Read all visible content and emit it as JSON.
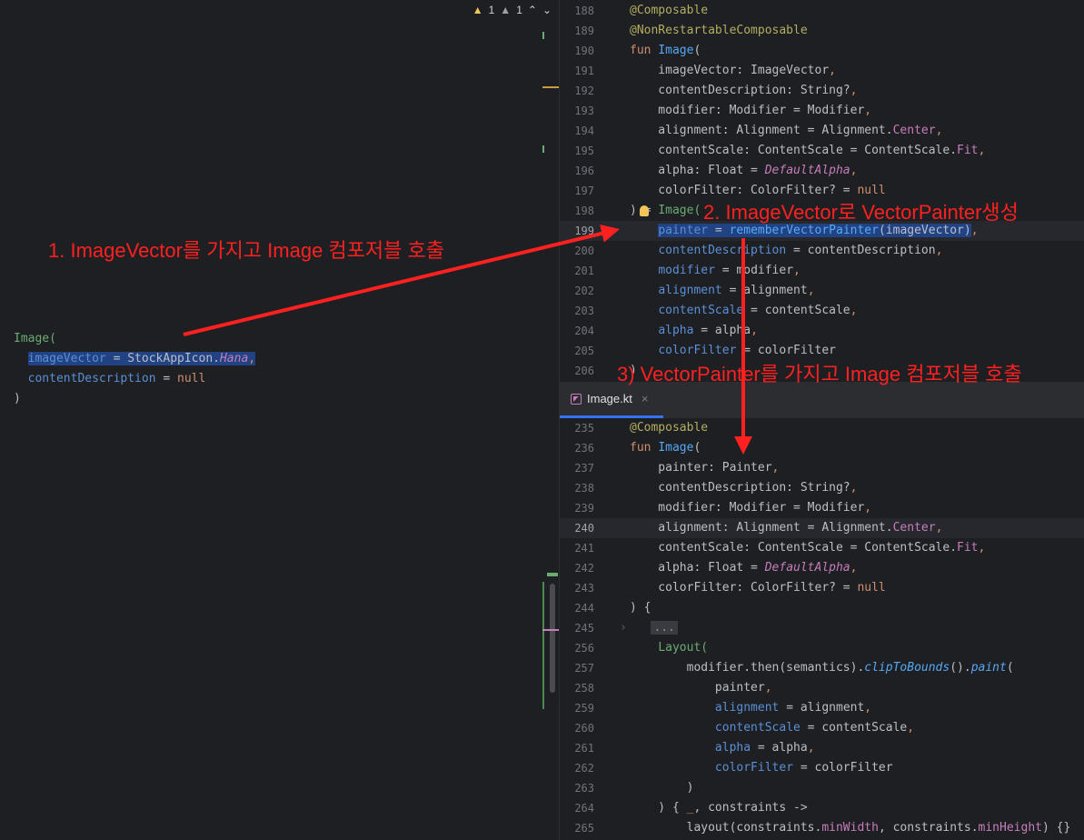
{
  "status": {
    "warnings": "1",
    "weak_warnings": "1",
    "up_arrow": "⌃",
    "down_arrow": "⌄"
  },
  "left_code": {
    "lines": [
      {
        "tokens": [
          {
            "t": "Image(",
            "c": "green"
          }
        ]
      },
      {
        "tokens": [
          {
            "t": "  ",
            "c": ""
          },
          {
            "t": "imageVector",
            "c": "param hl"
          },
          {
            "t": " = ",
            "c": "hl"
          },
          {
            "t": "StockAppIcon.",
            "c": "hl"
          },
          {
            "t": "Hana",
            "c": "ital hl"
          },
          {
            "t": ",",
            "c": "kw hl"
          }
        ]
      },
      {
        "tokens": [
          {
            "t": "  ",
            "c": ""
          },
          {
            "t": "contentDescription",
            "c": "param"
          },
          {
            "t": " = ",
            "c": ""
          },
          {
            "t": "null",
            "c": "kw"
          }
        ]
      },
      {
        "tokens": [
          {
            "t": ")",
            "c": ""
          }
        ]
      }
    ]
  },
  "top_code": {
    "lines": [
      {
        "n": "188",
        "tokens": [
          {
            "t": "@Composable",
            "c": "anno"
          }
        ]
      },
      {
        "n": "189",
        "tokens": [
          {
            "t": "@NonRestartableComposable",
            "c": "anno"
          }
        ]
      },
      {
        "n": "190",
        "tokens": [
          {
            "t": "fun ",
            "c": "kw"
          },
          {
            "t": "Image",
            "c": "fn"
          },
          {
            "t": "(",
            "c": ""
          }
        ]
      },
      {
        "n": "191",
        "tokens": [
          {
            "t": "    imageVector: ImageVector",
            "c": ""
          },
          {
            "t": ",",
            "c": "kw"
          }
        ]
      },
      {
        "n": "192",
        "tokens": [
          {
            "t": "    contentDescription: String?",
            "c": ""
          },
          {
            "t": ",",
            "c": "kw"
          }
        ]
      },
      {
        "n": "193",
        "tokens": [
          {
            "t": "    modifier: Modifier = Modifier",
            "c": ""
          },
          {
            "t": ",",
            "c": "kw"
          }
        ]
      },
      {
        "n": "194",
        "tokens": [
          {
            "t": "    alignment: Alignment = Alignment.",
            "c": ""
          },
          {
            "t": "Center",
            "c": "enumc"
          },
          {
            "t": ",",
            "c": "kw"
          }
        ]
      },
      {
        "n": "195",
        "tokens": [
          {
            "t": "    contentScale: ContentScale = ContentScale.",
            "c": ""
          },
          {
            "t": "Fit",
            "c": "enumc"
          },
          {
            "t": ",",
            "c": "kw"
          }
        ]
      },
      {
        "n": "196",
        "tokens": [
          {
            "t": "    alpha: Float = ",
            "c": ""
          },
          {
            "t": "DefaultAlpha",
            "c": "ital"
          },
          {
            "t": ",",
            "c": "kw"
          }
        ]
      },
      {
        "n": "197",
        "tokens": [
          {
            "t": "    colorFilter: ColorFilter? = ",
            "c": ""
          },
          {
            "t": "null",
            "c": "kw"
          }
        ]
      },
      {
        "n": "198",
        "tokens": [
          {
            "t": ") = ",
            "c": ""
          },
          {
            "t": "Image(",
            "c": "green"
          }
        ]
      },
      {
        "n": "199",
        "cur": true,
        "tokens": [
          {
            "t": "    ",
            "c": ""
          },
          {
            "t": "painter",
            "c": "param hl"
          },
          {
            "t": " = ",
            "c": "hl"
          },
          {
            "t": "rememberVectorPainter",
            "c": "fncall hl"
          },
          {
            "t": "(imageVector)",
            "c": "hl"
          },
          {
            "t": ",",
            "c": "kw"
          }
        ]
      },
      {
        "n": "200",
        "tokens": [
          {
            "t": "    ",
            "c": ""
          },
          {
            "t": "contentDescription",
            "c": "param"
          },
          {
            "t": " = contentDescription",
            "c": ""
          },
          {
            "t": ",",
            "c": "kw"
          }
        ]
      },
      {
        "n": "201",
        "tokens": [
          {
            "t": "    ",
            "c": ""
          },
          {
            "t": "modifier",
            "c": "param"
          },
          {
            "t": " = modifier",
            "c": ""
          },
          {
            "t": ",",
            "c": "kw"
          }
        ]
      },
      {
        "n": "202",
        "tokens": [
          {
            "t": "    ",
            "c": ""
          },
          {
            "t": "alignment",
            "c": "param"
          },
          {
            "t": " = alignment",
            "c": ""
          },
          {
            "t": ",",
            "c": "kw"
          }
        ]
      },
      {
        "n": "203",
        "tokens": [
          {
            "t": "    ",
            "c": ""
          },
          {
            "t": "contentScale",
            "c": "param"
          },
          {
            "t": " = contentScale",
            "c": ""
          },
          {
            "t": ",",
            "c": "kw"
          }
        ]
      },
      {
        "n": "204",
        "tokens": [
          {
            "t": "    ",
            "c": ""
          },
          {
            "t": "alpha",
            "c": "param"
          },
          {
            "t": " = alpha",
            "c": ""
          },
          {
            "t": ",",
            "c": "kw"
          }
        ]
      },
      {
        "n": "205",
        "tokens": [
          {
            "t": "    ",
            "c": ""
          },
          {
            "t": "colorFilter",
            "c": "param"
          },
          {
            "t": " = colorFilter",
            "c": ""
          }
        ]
      },
      {
        "n": "206",
        "tokens": [
          {
            "t": ")",
            "c": ""
          }
        ]
      }
    ]
  },
  "tab": {
    "label": "Image.kt",
    "close": "×"
  },
  "bottom_code": {
    "lines": [
      {
        "n": "235",
        "tokens": [
          {
            "t": "@Composable",
            "c": "anno"
          }
        ]
      },
      {
        "n": "236",
        "tokens": [
          {
            "t": "fun ",
            "c": "kw"
          },
          {
            "t": "Image",
            "c": "fn"
          },
          {
            "t": "(",
            "c": ""
          }
        ]
      },
      {
        "n": "237",
        "tokens": [
          {
            "t": "    painter: Painter",
            "c": ""
          },
          {
            "t": ",",
            "c": "kw"
          }
        ]
      },
      {
        "n": "238",
        "tokens": [
          {
            "t": "    contentDescription: String?",
            "c": ""
          },
          {
            "t": ",",
            "c": "kw"
          }
        ]
      },
      {
        "n": "239",
        "tokens": [
          {
            "t": "    modifier: Modifier = Modifier",
            "c": ""
          },
          {
            "t": ",",
            "c": "kw"
          }
        ]
      },
      {
        "n": "240",
        "cur": true,
        "tokens": [
          {
            "t": "    alignment: Alignment = Alignment.",
            "c": ""
          },
          {
            "t": "Center",
            "c": "enumc"
          },
          {
            "t": ",",
            "c": "kw"
          }
        ]
      },
      {
        "n": "241",
        "tokens": [
          {
            "t": "    contentScale: ContentScale = ContentScale.",
            "c": ""
          },
          {
            "t": "Fit",
            "c": "enumc"
          },
          {
            "t": ",",
            "c": "kw"
          }
        ]
      },
      {
        "n": "242",
        "tokens": [
          {
            "t": "    alpha: Float = ",
            "c": ""
          },
          {
            "t": "DefaultAlpha",
            "c": "ital"
          },
          {
            "t": ",",
            "c": "kw"
          }
        ]
      },
      {
        "n": "243",
        "tokens": [
          {
            "t": "    colorFilter: ColorFilter? = ",
            "c": ""
          },
          {
            "t": "null",
            "c": "kw"
          }
        ]
      },
      {
        "n": "244",
        "tokens": [
          {
            "t": ") {",
            "c": ""
          }
        ]
      },
      {
        "n": "245",
        "fold": true,
        "tokens": [
          {
            "t": "   ",
            "c": ""
          },
          {
            "t": "...",
            "c": "folded"
          }
        ]
      },
      {
        "n": "256",
        "tokens": [
          {
            "t": "    ",
            "c": ""
          },
          {
            "t": "Layout(",
            "c": "green"
          }
        ]
      },
      {
        "n": "257",
        "tokens": [
          {
            "t": "        modifier.then(semantics).",
            "c": ""
          },
          {
            "t": "clipToBounds",
            "c": "extfn"
          },
          {
            "t": "().",
            "c": ""
          },
          {
            "t": "paint",
            "c": "extfn"
          },
          {
            "t": "(",
            "c": ""
          }
        ]
      },
      {
        "n": "258",
        "tokens": [
          {
            "t": "            painter",
            "c": ""
          },
          {
            "t": ",",
            "c": "kw"
          }
        ]
      },
      {
        "n": "259",
        "tokens": [
          {
            "t": "            ",
            "c": ""
          },
          {
            "t": "alignment",
            "c": "param"
          },
          {
            "t": " = alignment",
            "c": ""
          },
          {
            "t": ",",
            "c": "kw"
          }
        ]
      },
      {
        "n": "260",
        "tokens": [
          {
            "t": "            ",
            "c": ""
          },
          {
            "t": "contentScale",
            "c": "param"
          },
          {
            "t": " = contentScale",
            "c": ""
          },
          {
            "t": ",",
            "c": "kw"
          }
        ]
      },
      {
        "n": "261",
        "tokens": [
          {
            "t": "            ",
            "c": ""
          },
          {
            "t": "alpha",
            "c": "param"
          },
          {
            "t": " = alpha",
            "c": ""
          },
          {
            "t": ",",
            "c": "kw"
          }
        ]
      },
      {
        "n": "262",
        "tokens": [
          {
            "t": "            ",
            "c": ""
          },
          {
            "t": "colorFilter",
            "c": "param"
          },
          {
            "t": " = colorFilter",
            "c": ""
          }
        ]
      },
      {
        "n": "263",
        "tokens": [
          {
            "t": "        )",
            "c": ""
          }
        ]
      },
      {
        "n": "264",
        "tokens": [
          {
            "t": "    ) { ",
            "c": ""
          },
          {
            "t": "_",
            "c": "kw"
          },
          {
            "t": ", constraints ->",
            "c": ""
          }
        ]
      },
      {
        "n": "265",
        "tokens": [
          {
            "t": "        layout(constraints.",
            "c": ""
          },
          {
            "t": "minWidth",
            "c": "enumc"
          },
          {
            "t": ", constraints.",
            "c": ""
          },
          {
            "t": "minHeight",
            "c": "enumc"
          },
          {
            "t": ") {}",
            "c": ""
          }
        ]
      }
    ]
  },
  "annotations": {
    "step1": "1. ImageVector를 가지고 Image 컴포저블 호출",
    "step2": "2. ImageVector로 VectorPainter생성",
    "step3": "3) VectorPainter를 가지고  Image 컴포저블 호출"
  },
  "colors": {
    "annotation": "#ff2020",
    "accent": "#3574f0"
  }
}
